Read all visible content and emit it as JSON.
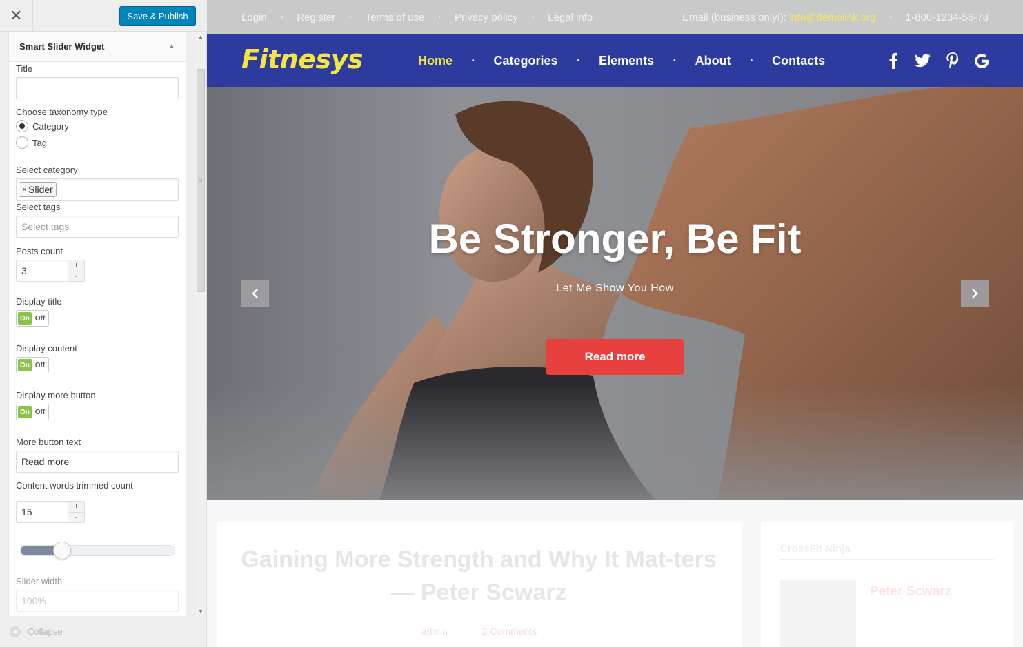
{
  "customizer": {
    "close_icon": "close-icon",
    "save_label": "Save & Publish",
    "widget_title": "Smart Slider Widget",
    "fields": {
      "title_label": "Title",
      "title_value": "",
      "taxonomy_label": "Choose taxonomy type",
      "taxonomy_options": [
        "Category",
        "Tag"
      ],
      "taxonomy_selected": "Category",
      "category_label": "Select category",
      "category_chip": "Slider",
      "tags_label": "Select tags",
      "tags_placeholder": "Select tags",
      "posts_count_label": "Posts count",
      "posts_count_value": "3",
      "display_title_label": "Display title",
      "display_content_label": "Display content",
      "display_more_label": "Display more button",
      "toggle_on": "On",
      "toggle_off": "Off",
      "more_text_label": "More button text",
      "more_text_value": "Read more",
      "trim_label": "Content words trimmed count",
      "trim_value": "15",
      "slider_width_label": "Slider width",
      "slider_width_value": "100%"
    },
    "range_fraction": 0.27,
    "collapse_label": "Collapse"
  },
  "preview": {
    "topbar": {
      "links": [
        "Login",
        "Register",
        "Terms of use",
        "Privacy policy",
        "Legal info"
      ],
      "email_label": "Email (business only!):",
      "email": "info@demolink.org",
      "phone": "1-800-1234-56-78"
    },
    "logo": "Fitnesys",
    "menu": [
      "Home",
      "Categories",
      "Elements",
      "About",
      "Contacts"
    ],
    "menu_active": "Home",
    "socials": [
      "facebook-icon",
      "twitter-icon",
      "pinterest-icon",
      "google-icon"
    ],
    "hero": {
      "title": "Be Stronger, Be Fit",
      "subtitle": "Let Me Show You How",
      "button": "Read more"
    },
    "post": {
      "title": "Gaining More Strength and Why It Mat-ters — Peter Scwarz",
      "meta_author": "admin",
      "meta_comments": "2 Comments"
    },
    "sidebar": {
      "heading": "CrossFit Ninja",
      "author_name": "Peter Scwarz"
    },
    "colors": {
      "nav_bg": "#2e3b9e",
      "accent_yellow": "#f3e640",
      "button_red": "#e8403f",
      "publish_blue": "#0085ba"
    }
  }
}
